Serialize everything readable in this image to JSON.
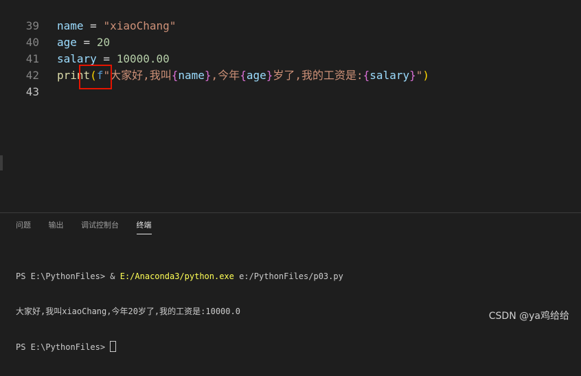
{
  "editor": {
    "lines": [
      {
        "number": "39"
      },
      {
        "number": "40",
        "var": "name",
        "op": " = ",
        "value": "\"xiaoChang\""
      },
      {
        "number": "41",
        "var": "age",
        "op": " = ",
        "value": "20"
      },
      {
        "number": "42",
        "var": "salary",
        "op": " = ",
        "value": "10000.00"
      },
      {
        "number": "43",
        "fn": "print",
        "open_paren": "(",
        "prefix": "f",
        "str_start": "\"大家好,我叫",
        "b1_open": "{",
        "b1_var": "name",
        "b1_close": "}",
        "str_mid1": ",今年",
        "b2_open": "{",
        "b2_var": "age",
        "b2_close": "}",
        "str_mid2": "岁了,我的工资是:",
        "b3_open": "{",
        "b3_var": "salary",
        "b3_close": "}",
        "str_end": "\"",
        "close_paren": ")"
      }
    ]
  },
  "panel": {
    "tabs": [
      {
        "label": "问题"
      },
      {
        "label": "输出"
      },
      {
        "label": "调试控制台"
      },
      {
        "label": "终端",
        "active": true
      }
    ],
    "terminal": {
      "line1_prompt": "PS E:\\PythonFiles> & ",
      "line1_exe": "E:/Anaconda3/python.exe",
      "line1_arg": " e:/PythonFiles/p03.py",
      "line2": "大家好,我叫xiaoChang,今年20岁了,我的工资是:10000.0",
      "line3_prompt": "PS E:\\PythonFiles> "
    }
  },
  "watermark": "CSDN @ya鸡给给",
  "colors": {
    "background": "#1e1e1e",
    "highlight_box": "#e51400"
  }
}
